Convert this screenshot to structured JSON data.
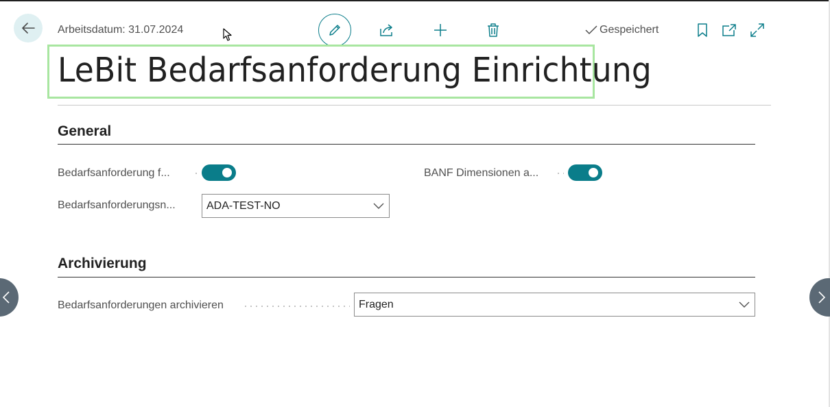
{
  "header": {
    "work_date": "Arbeitsdatum: 31.07.2024",
    "saved_status": "Gespeichert"
  },
  "page": {
    "title": "LeBit Bedarfsanforderung Einrichtung"
  },
  "sections": {
    "general": {
      "heading": "General",
      "fields": {
        "req_toggle_label": "Bedarfsanforderung f...",
        "req_toggle_value": true,
        "banf_dim_label": "BANF Dimensionen a...",
        "banf_dim_value": true,
        "req_nos_label": "Bedarfsanforderungsn...",
        "req_nos_value": "ADA-TEST-NO"
      }
    },
    "archiving": {
      "heading": "Archivierung",
      "fields": {
        "archive_label": "Bedarfsanforderungen archivieren",
        "archive_value": "Fragen"
      }
    }
  },
  "colors": {
    "accent": "#0a7d8a",
    "focus_outline": "#a8e6a0",
    "back_button_bg": "#dff0f2",
    "nav_circle": "#5b6975"
  },
  "icons": [
    "back-arrow-icon",
    "pencil-icon",
    "share-icon",
    "plus-icon",
    "trash-icon",
    "checkmark-icon",
    "bookmark-icon",
    "popout-icon",
    "expand-icon",
    "chevron-left-icon",
    "chevron-right-icon",
    "chevron-down-icon",
    "mouse-cursor-icon"
  ]
}
